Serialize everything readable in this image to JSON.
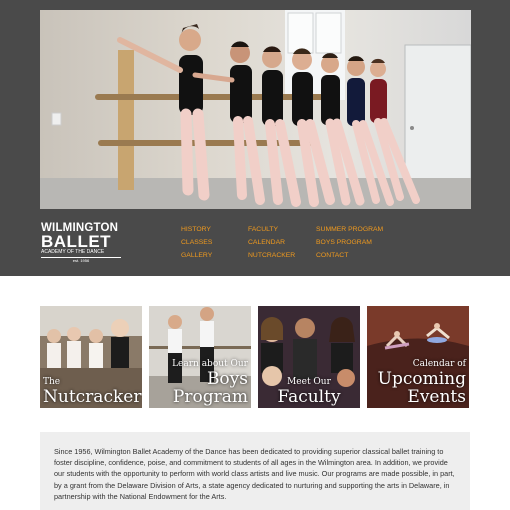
{
  "logo": {
    "line1": "WILMINGTON",
    "line2": "BALLET",
    "line3": "ACADEMY OF THE DANCE",
    "line4": "est. 1956"
  },
  "nav": {
    "col1": [
      "HISTORY",
      "CLASSES",
      "GALLERY"
    ],
    "col2": [
      "FACULTY",
      "CALENDAR",
      "NUTCRACKER"
    ],
    "col3": [
      "SUMMER PROGRAM",
      "BOYS PROGRAM",
      "CONTACT"
    ]
  },
  "tiles": [
    {
      "small": "The",
      "big": "Nutcracker"
    },
    {
      "small": "Learn about Our",
      "big": "Boys Program"
    },
    {
      "small": "Meet Our",
      "big": "Faculty"
    },
    {
      "small": "Calendar of",
      "big": "Upcoming Events"
    }
  ],
  "about": {
    "text": "Since 1956, Wilmington Ballet Academy of the Dance has been dedicated to providing superior classical ballet training to foster discipline, confidence, poise, and commitment to students of all ages in the Wilmington area. In addition, we provide our students with the opportunity to perform with world class artists and live music. Our programs are made possible, in part, by a grant from the Delaware Division of Arts, a state agency dedicated to nurturing and supporting the arts in Delaware, in partnership with the National Endowment for the Arts."
  },
  "colors": {
    "header_bg": "#4a4a4a",
    "nav_link": "#f09a1e",
    "about_bg": "#eeeeee"
  }
}
